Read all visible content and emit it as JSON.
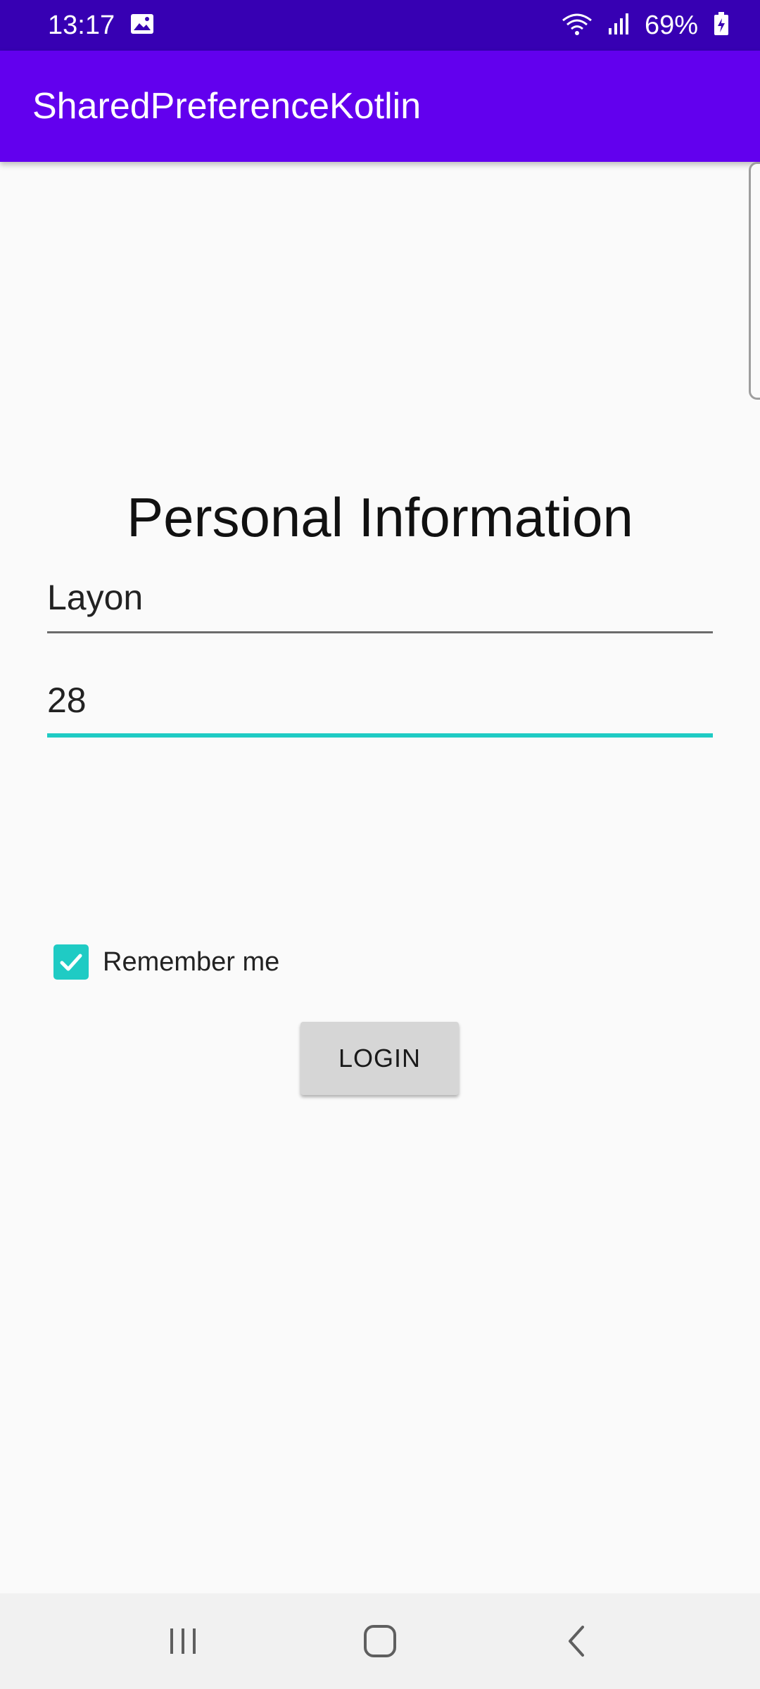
{
  "status_bar": {
    "time": "13:17",
    "battery": "69%",
    "icons": [
      "image-icon",
      "wifi-icon",
      "signal-icon",
      "battery-icon"
    ]
  },
  "app_bar": {
    "title": "SharedPreferenceKotlin"
  },
  "form": {
    "heading": "Personal Information",
    "name_value": "Layon",
    "age_value": "28",
    "remember_label": "Remember me",
    "remember_checked": true,
    "login_label": "LOGIN"
  },
  "nav_bar": {
    "buttons": [
      "recents-icon",
      "home-icon",
      "back-icon"
    ]
  },
  "colors": {
    "status_bar": "#3700b3",
    "app_bar": "#6200ee",
    "accent": "#1fcbc4",
    "background": "#fafafa"
  }
}
